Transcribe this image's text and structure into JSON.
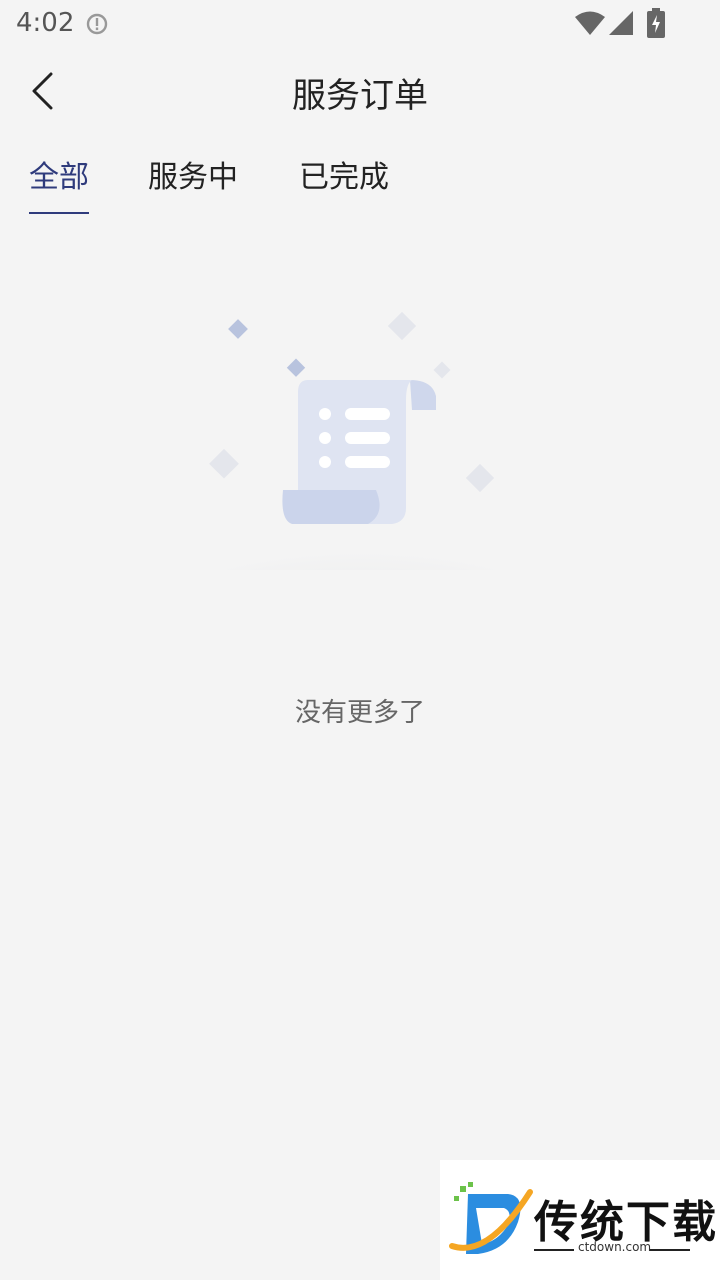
{
  "status_bar": {
    "time": "4:02",
    "icons": [
      "alert-circle-icon",
      "wifi-icon",
      "signal-icon",
      "battery-charging-icon"
    ]
  },
  "header": {
    "title": "服务订单",
    "back_icon": "chevron-left-icon"
  },
  "tabs": [
    {
      "label": "全部",
      "active": true
    },
    {
      "label": "服务中",
      "active": false
    },
    {
      "label": "已完成",
      "active": false
    }
  ],
  "empty_state": {
    "illustration": "empty-list-scroll-icon",
    "message": "没有更多了"
  },
  "watermark": {
    "name": "传统下载",
    "url": "ctdown.com"
  },
  "colors": {
    "background": "#f4f4f4",
    "accent": "#2f3b7c",
    "text": "#222222",
    "muted_text": "#666666"
  }
}
